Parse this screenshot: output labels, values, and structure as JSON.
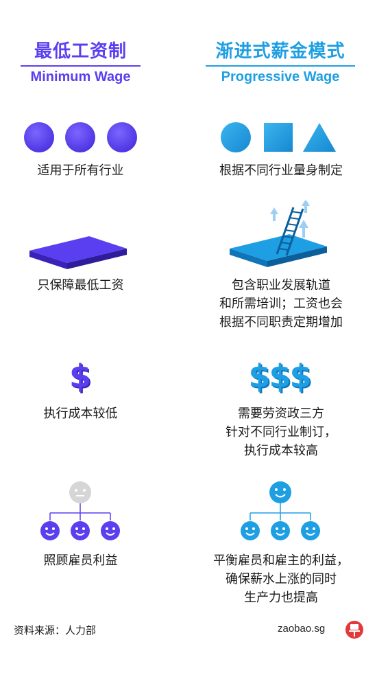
{
  "colors": {
    "purple": "#5a3ff0",
    "blue": "#1e9fe3",
    "gray": "#d6d6d6",
    "text": "#1a1a1a"
  },
  "left": {
    "title_cn": "最低工资制",
    "title_en": "Minimum Wage",
    "rows": [
      {
        "text": "适用于所有行业"
      },
      {
        "text": "只保障最低工资"
      },
      {
        "text": "执行成本较低"
      },
      {
        "text": "照顾雇员利益"
      }
    ]
  },
  "right": {
    "title_cn": "渐进式薪金模式",
    "title_en": "Progressive Wage",
    "rows": [
      {
        "lines": [
          "根据不同行业量身制定"
        ]
      },
      {
        "lines": [
          "包含职业发展轨道",
          "和所需培训；工资也会",
          "根据不同职责定期增加"
        ]
      },
      {
        "lines": [
          "需要劳资政三方",
          "针对不同行业制订，",
          "执行成本较高"
        ]
      },
      {
        "lines": [
          "平衡雇员和雇主的利益，",
          "确保薪水上涨的同时",
          "生产力也提高"
        ]
      }
    ]
  },
  "icons": {
    "dollar": "$",
    "dollars": "$$$"
  },
  "footer": {
    "source": "资料来源：人力部",
    "site": "zaobao.sg"
  }
}
